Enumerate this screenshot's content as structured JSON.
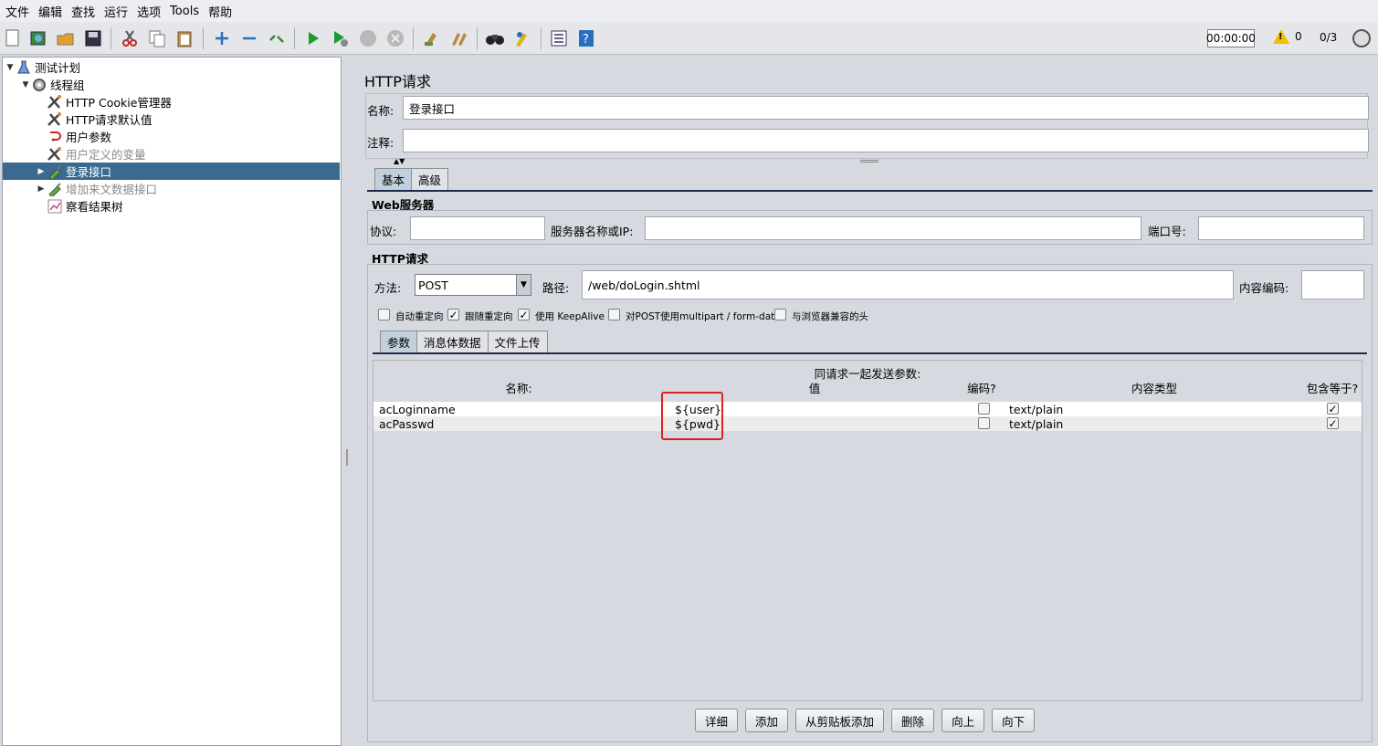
{
  "menu": [
    "文件",
    "编辑",
    "查找",
    "运行",
    "选项",
    "Tools",
    "帮助"
  ],
  "toolbar": {
    "icons": [
      "new-icon",
      "templates-icon",
      "open-icon",
      "save-icon",
      "cut-icon",
      "copy-icon",
      "paste-icon",
      "expand-icon",
      "collapse-icon",
      "toggle-icon",
      "start-icon",
      "start-no-pause-icon",
      "stop-icon",
      "shutdown-icon",
      "clear-icon",
      "clear-all-icon",
      "search-icon",
      "reset-search-icon",
      "function-helper-icon",
      "help-icon"
    ],
    "timer": "00:00:00",
    "warn_count": "0",
    "threads": "0/3"
  },
  "tree": [
    {
      "label": "测试计划",
      "icon": "test-plan-icon",
      "arrow": "▼",
      "indent": 0,
      "selected": false,
      "disabled": false
    },
    {
      "label": "线程组",
      "icon": "thread-group-icon",
      "arrow": "▼",
      "indent": 1,
      "selected": false,
      "disabled": false
    },
    {
      "label": "HTTP Cookie管理器",
      "icon": "config-element-icon",
      "arrow": "",
      "indent": 2,
      "selected": false,
      "disabled": false
    },
    {
      "label": "HTTP请求默认值",
      "icon": "config-element-icon",
      "arrow": "",
      "indent": 2,
      "selected": false,
      "disabled": false
    },
    {
      "label": "用户参数",
      "icon": "pre-processor-icon",
      "arrow": "",
      "indent": 2,
      "selected": false,
      "disabled": false
    },
    {
      "label": "用户定义的变量",
      "icon": "config-element-icon",
      "arrow": "",
      "indent": 2,
      "selected": false,
      "disabled": true
    },
    {
      "label": "登录接口",
      "icon": "sampler-icon",
      "arrow": "▶",
      "indent": 2,
      "selected": true,
      "disabled": false
    },
    {
      "label": "增加来文数据接口",
      "icon": "sampler-icon",
      "arrow": "▶",
      "indent": 2,
      "selected": false,
      "disabled": true
    },
    {
      "label": "察看结果树",
      "icon": "listener-icon",
      "arrow": "",
      "indent": 2,
      "selected": false,
      "disabled": false
    }
  ],
  "panel": {
    "title": "HTTP请求",
    "name_label": "名称:",
    "name_value": "登录接口",
    "comment_label": "注释:",
    "comment_value": "",
    "tabs": [
      "基本",
      "高级"
    ],
    "web_server": {
      "title": "Web服务器",
      "protocol_label": "协议:",
      "protocol_value": "",
      "server_label": "服务器名称或IP:",
      "server_value": "",
      "port_label": "端口号:",
      "port_value": ""
    },
    "http_request": {
      "title": "HTTP请求",
      "method_label": "方法:",
      "method_value": "POST",
      "path_label": "路径:",
      "path_value": "/web/doLogin.shtml",
      "encoding_label": "内容编码:",
      "encoding_value": ""
    },
    "options": [
      {
        "label": "自动重定向",
        "checked": false
      },
      {
        "label": "跟随重定向",
        "checked": true
      },
      {
        "label": "使用 KeepAlive",
        "checked": true
      },
      {
        "label": "对POST使用multipart / form-data",
        "checked": false
      },
      {
        "label": "与浏览器兼容的头",
        "checked": false
      }
    ],
    "sub_tabs": [
      "参数",
      "消息体数据",
      "文件上传"
    ],
    "params": {
      "caption": "同请求一起发送参数:",
      "headers": [
        "名称:",
        "值",
        "编码?",
        "内容类型",
        "包含等于?"
      ],
      "rows": [
        {
          "name": "acLoginname",
          "value": "${user}",
          "encode": false,
          "content_type": "text/plain",
          "include_equals": true
        },
        {
          "name": "acPasswd",
          "value": "${pwd}",
          "encode": false,
          "content_type": "text/plain",
          "include_equals": true
        }
      ]
    },
    "buttons": [
      "详细",
      "添加",
      "从剪贴板添加",
      "删除",
      "向上",
      "向下"
    ]
  },
  "colors": {
    "selection": "#3a6a8f",
    "highlight_box": "#e02020",
    "tab_active": "#c2cfdc"
  }
}
